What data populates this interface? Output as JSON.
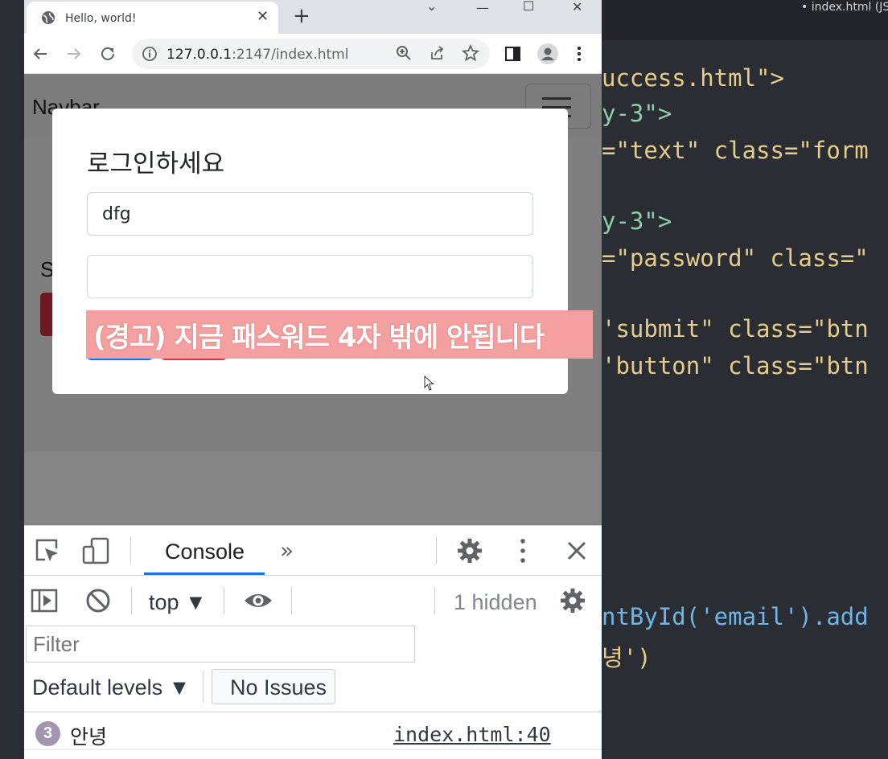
{
  "browser": {
    "tab_title": "Hello, world!",
    "tab_close": "✕",
    "new_tab": "+",
    "url_host": "127.0.0.1",
    "url_rest": ":2147/index.html",
    "window_controls": [
      "⌄",
      "—",
      "☐",
      "✕"
    ]
  },
  "page": {
    "navbar_brand": "Navbar",
    "background_heading_fragment": "S",
    "modal": {
      "title": "로그인하세요",
      "email_value": "dfg",
      "password_value": ""
    },
    "warning_overlay": "(경고) 지금 패스워드 4자 밖에 안됩니다"
  },
  "devtools": {
    "tab_console": "Console",
    "more_tabs": "»",
    "context": "top ▼",
    "hidden_count": "1 hidden",
    "filter_placeholder": "Filter",
    "default_levels": "Default levels ▼",
    "issues_button": "No Issues",
    "log": {
      "count": "3",
      "message": "안녕",
      "source": "index.html:40"
    }
  },
  "editor": {
    "tab_title": "• index.html (JS)",
    "lines": [
      "uccess.html\">",
      "y-3\">",
      "=\"text\" class=\"form",
      "y-3\">",
      "=\"password\" class=\"",
      "'submit\" class=\"btn",
      "'button\" class=\"btn",
      "ntById('email').add",
      "녕')"
    ]
  },
  "colors": {
    "primary": "#0d6efd",
    "danger": "#dc3545",
    "warning_bg": "#f4a0a0",
    "devtools_accent": "#1a73e8",
    "editor_bg": "#2b2d34"
  }
}
